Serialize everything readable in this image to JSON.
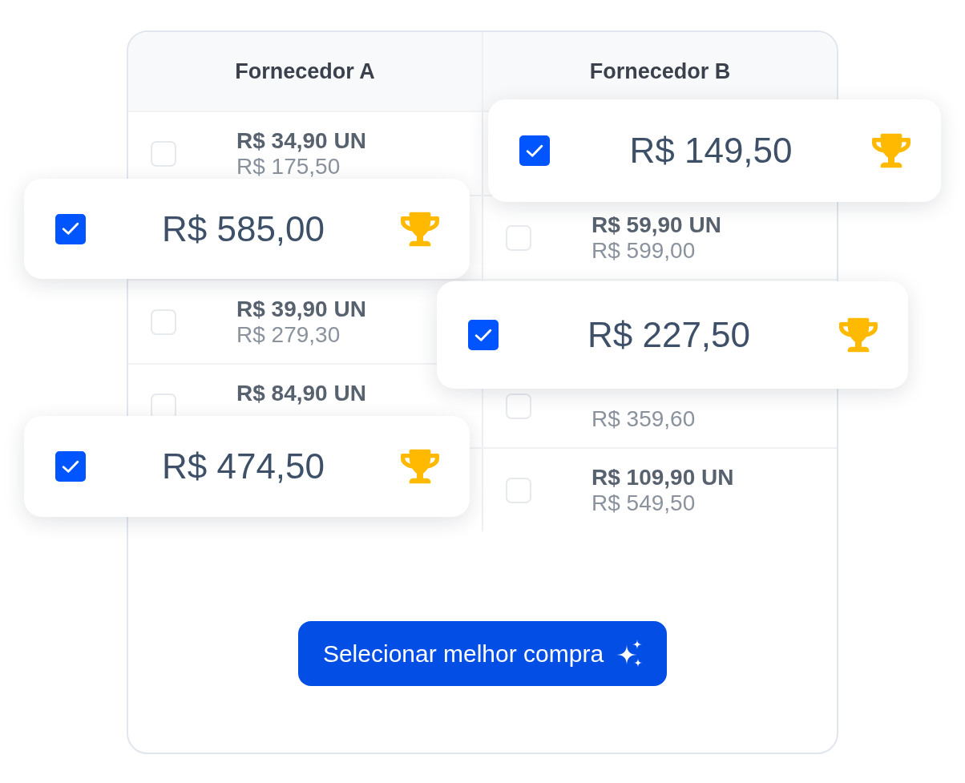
{
  "table": {
    "columns": [
      "Fornecedor A",
      "Fornecedor B"
    ],
    "rows": [
      {
        "cells": [
          {
            "checked": false,
            "unit_price": "R$ 34,90 UN",
            "total": "R$ 175,50"
          },
          {}
        ]
      },
      {
        "cells": [
          {},
          {
            "checked": false,
            "unit_price": "R$ 59,90 UN",
            "total": "R$ 599,00"
          }
        ]
      },
      {
        "cells": [
          {
            "checked": false,
            "unit_price": "R$ 39,90 UN",
            "total": "R$ 279,30"
          },
          {}
        ]
      },
      {
        "cells": [
          {
            "checked": false,
            "unit_price": "R$ 84,90 UN"
          },
          {
            "checked": false,
            "total": "R$ 359,60"
          }
        ]
      },
      {
        "cells": [
          {},
          {
            "checked": false,
            "unit_price": "R$ 109,90 UN",
            "total": "R$ 549,50"
          }
        ]
      }
    ]
  },
  "highlight_cards": [
    {
      "checked": true,
      "total": "R$ 149,50"
    },
    {
      "checked": true,
      "total": "R$ 585,00"
    },
    {
      "checked": true,
      "total": "R$ 227,50"
    },
    {
      "checked": true,
      "total": "R$ 474,50"
    }
  ],
  "button": {
    "label": "Selecionar melhor compra"
  }
}
